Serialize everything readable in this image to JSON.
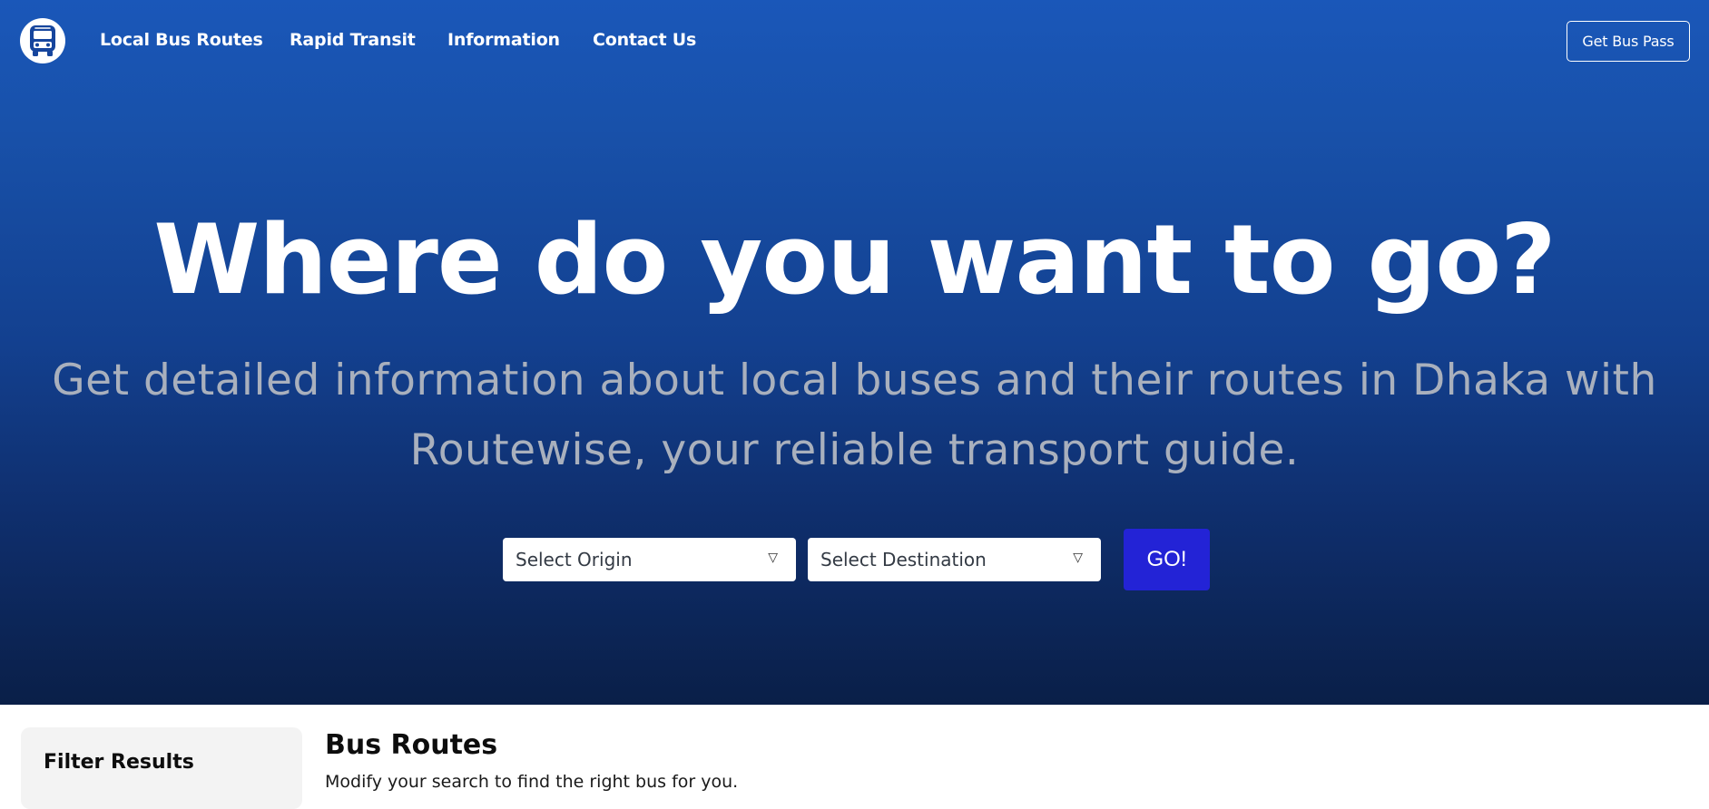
{
  "colors": {
    "hero_top": "#1a57b9",
    "hero_bottom": "#0a1f48",
    "go_button": "#2323d6",
    "subtitle": "#a9b0bd"
  },
  "brand": {
    "logo_icon": "bus-icon"
  },
  "nav": {
    "items": [
      {
        "label": "Local Bus Routes"
      },
      {
        "label": "Rapid Transit"
      },
      {
        "label": "Information"
      },
      {
        "label": "Contact Us"
      }
    ],
    "cta_label": "Get Bus Pass"
  },
  "hero": {
    "title": "Where do you want to go?",
    "subtitle": "Get detailed information about local buses and their routes in Dhaka with Routewise, your reliable transport guide."
  },
  "search": {
    "origin_placeholder": "Select Origin",
    "destination_placeholder": "Select Destination",
    "caret_glyph": "▽",
    "go_label": "GO!"
  },
  "filters": {
    "title": "Filter Results"
  },
  "results": {
    "title": "Bus Routes",
    "subtitle": "Modify your search to find the right bus for you."
  }
}
